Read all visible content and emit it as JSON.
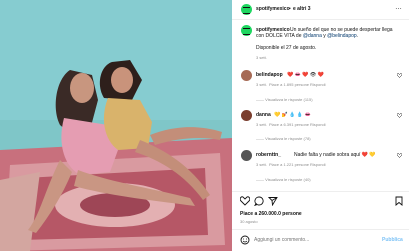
{
  "header": {
    "username": "spotifymexico",
    "separator": "•",
    "collab": "e altri 3",
    "more": "…"
  },
  "caption": {
    "username": "spotifymexico",
    "line1": "Un sueño del que no se puede despertar llega",
    "line2_pre": "con DOLCE VITA de ",
    "mention1": "@danna",
    "line2_mid": " y ",
    "mention2": "@belindapop",
    "line2_end": ".",
    "line3": "Disponible el 27 de agosto.",
    "age": "3 sett."
  },
  "comments": [
    {
      "username": "belindapop",
      "text": "❤️ 👄 ❤️ 👁 ❤️",
      "age": "3 sett.",
      "likes": "Piace a 1.895 persone",
      "reply": "Rispondi",
      "view_replies": "Visualizza le risposte (115)"
    },
    {
      "username": "danna",
      "text": "💛 💅 💧 💧 👄",
      "age": "3 sett.",
      "likes": "Piace a 6.391 persone",
      "reply": "Rispondi",
      "view_replies": "Visualizza le risposte (78)"
    },
    {
      "username": "robernttn_",
      "text": "Nadie falta y nadie sobra aquí ❤️ 💛",
      "age": "3 sett.",
      "likes": "Piace a 1.221 persone",
      "reply": "Rispondi",
      "view_replies": "Visualizza le risposte (40)"
    }
  ],
  "post": {
    "likes": "Piace a 260.000.0 persone",
    "date": "30 agosto"
  },
  "add_comment": {
    "placeholder": "Aggiungi un commento...",
    "publish": "Pubblica"
  },
  "colors": {
    "spotify_green": "#1ed760",
    "photo_bg": "#7fc6c8",
    "rug": "#c8707d",
    "link_blue": "#00376b",
    "muted_grey": "#8e8e8e",
    "publish_blue": "#7cc2f6"
  }
}
